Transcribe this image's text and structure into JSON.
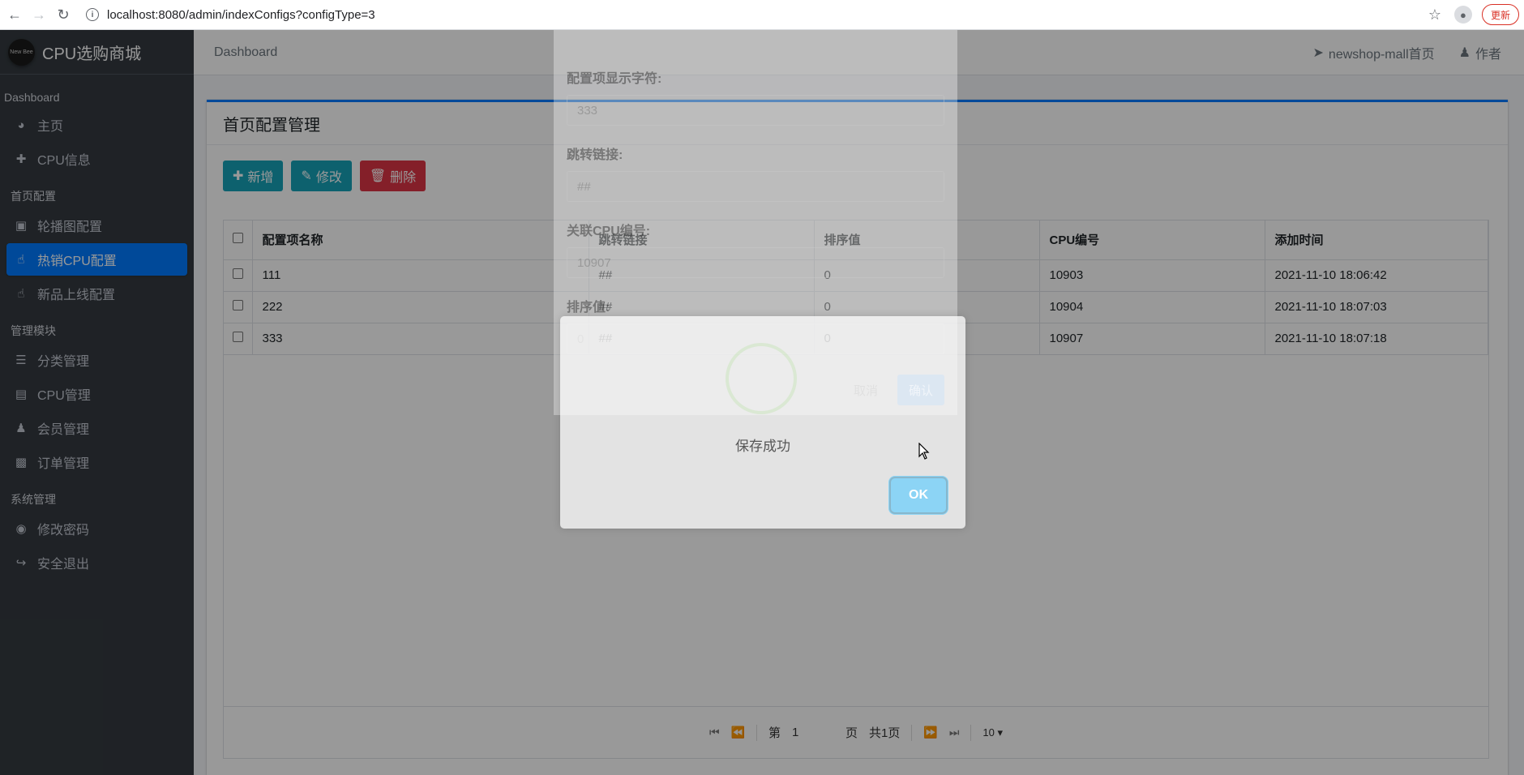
{
  "browser": {
    "url": "localhost:8080/admin/indexConfigs?configType=3",
    "update_label": "更新"
  },
  "sidebar": {
    "brand_logo_text": "New Bee",
    "brand": "CPU选购商城",
    "sections": [
      {
        "header": "Dashboard",
        "items": [
          {
            "label": "主页",
            "icon": "dashboard-icon"
          },
          {
            "label": "CPU信息",
            "icon": "plus-icon"
          }
        ]
      },
      {
        "header": "首页配置",
        "items": [
          {
            "label": "轮播图配置",
            "icon": "image-icon"
          },
          {
            "label": "热销CPU配置",
            "icon": "hand-pointer-icon",
            "active": true
          },
          {
            "label": "新品上线配置",
            "icon": "hand-pointer-icon"
          }
        ]
      },
      {
        "header": "管理模块",
        "items": [
          {
            "label": "分类管理",
            "icon": "list-icon"
          },
          {
            "label": "CPU管理",
            "icon": "archive-icon"
          },
          {
            "label": "会员管理",
            "icon": "users-icon"
          },
          {
            "label": "订单管理",
            "icon": "money-icon"
          }
        ]
      },
      {
        "header": "系统管理",
        "items": [
          {
            "label": "修改密码",
            "icon": "lock-icon"
          },
          {
            "label": "安全退出",
            "icon": "sign-out-icon"
          }
        ]
      }
    ]
  },
  "topbar": {
    "breadcrumb": "Dashboard",
    "home_link": "newshop-mall首页",
    "author_link": "作者"
  },
  "card": {
    "title": "首页配置管理",
    "buttons": {
      "add": "新增",
      "edit": "修改",
      "delete": "删除"
    },
    "columns": [
      "配置项名称",
      "跳转链接",
      "排序值",
      "CPU编号",
      "添加时间"
    ],
    "rows": [
      [
        "111",
        "##",
        "0",
        "10903",
        "2021-11-10 18:06:42"
      ],
      [
        "222",
        "##",
        "0",
        "10904",
        "2021-11-10 18:07:03"
      ],
      [
        "333",
        "##",
        "0",
        "10907",
        "2021-11-10 18:07:18"
      ]
    ],
    "pager": {
      "page_prefix": "第",
      "page_value": "1",
      "page_suffix": "页",
      "total": "共1页",
      "page_size": "10"
    }
  },
  "form_modal": {
    "fields": [
      {
        "label": "配置项显示字符:",
        "value": "333"
      },
      {
        "label": "跳转链接:",
        "value": "##"
      },
      {
        "label": "关联CPU编号:",
        "value": "10907"
      },
      {
        "label": "排序值:",
        "value": "0"
      }
    ],
    "cancel": "取消",
    "confirm": "确认"
  },
  "alert": {
    "message": "保存成功",
    "ok": "OK",
    "accent_color": "#8cd4f5"
  }
}
